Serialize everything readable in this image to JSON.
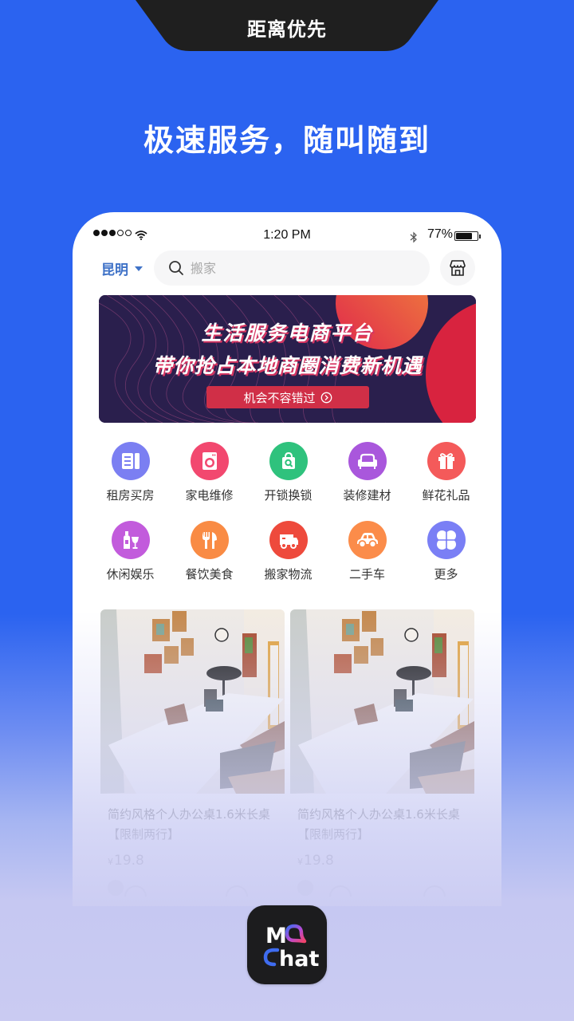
{
  "promo": {
    "tab_label": "距离优先",
    "headline": "极速服务，随叫随到",
    "colors": {
      "background_blue": "#2b63f0",
      "background_lavender": "#cacbf2",
      "tab_dark": "#1f1f1f"
    }
  },
  "status_bar": {
    "signal_filled": 3,
    "signal_total": 5,
    "time": "1:20 PM",
    "battery_percent_label": "77%",
    "battery_level": 0.77
  },
  "header": {
    "city": "昆明",
    "search_placeholder": "搬家",
    "store_icon": "store-icon",
    "accent_color": "#3f72c7"
  },
  "banner": {
    "line1": "生活服务电商平台",
    "line2": "带你抢占本地商圈消费新机遇",
    "cta_label": "机会不容错过"
  },
  "categories": [
    {
      "label": "租房买房",
      "icon": "document-icon",
      "color": "#7b7ff2"
    },
    {
      "label": "家电维修",
      "icon": "washing-machine-icon",
      "color": "#f2486f"
    },
    {
      "label": "开锁换锁",
      "icon": "bag-search-icon",
      "color": "#2fc27d"
    },
    {
      "label": "装修建材",
      "icon": "sofa-icon",
      "color": "#a957dc"
    },
    {
      "label": "鲜花礼品",
      "icon": "gift-icon",
      "color": "#f45a5a"
    },
    {
      "label": "休闲娱乐",
      "icon": "wine-icon",
      "color": "#c25bdc"
    },
    {
      "label": "餐饮美食",
      "icon": "cutlery-icon",
      "color": "#f98b44"
    },
    {
      "label": "搬家物流",
      "icon": "truck-icon",
      "color": "#ee4a3c"
    },
    {
      "label": "二手车",
      "icon": "car-icon",
      "color": "#fb8c4a"
    },
    {
      "label": "更多",
      "icon": "more-grid-icon",
      "color": "#7a7ff5"
    }
  ],
  "products": [
    {
      "title": "简约风格个人办公桌1.6米长桌【限制两行】",
      "currency": "¥",
      "price": "19.8",
      "image": "office-desk-photo"
    },
    {
      "title": "简约风格个人办公桌1.6米长桌【限制两行】",
      "currency": "¥",
      "price": "19.8",
      "image": "office-desk-photo"
    }
  ],
  "app": {
    "name_line1": "MQ",
    "name_line2": "chat"
  }
}
